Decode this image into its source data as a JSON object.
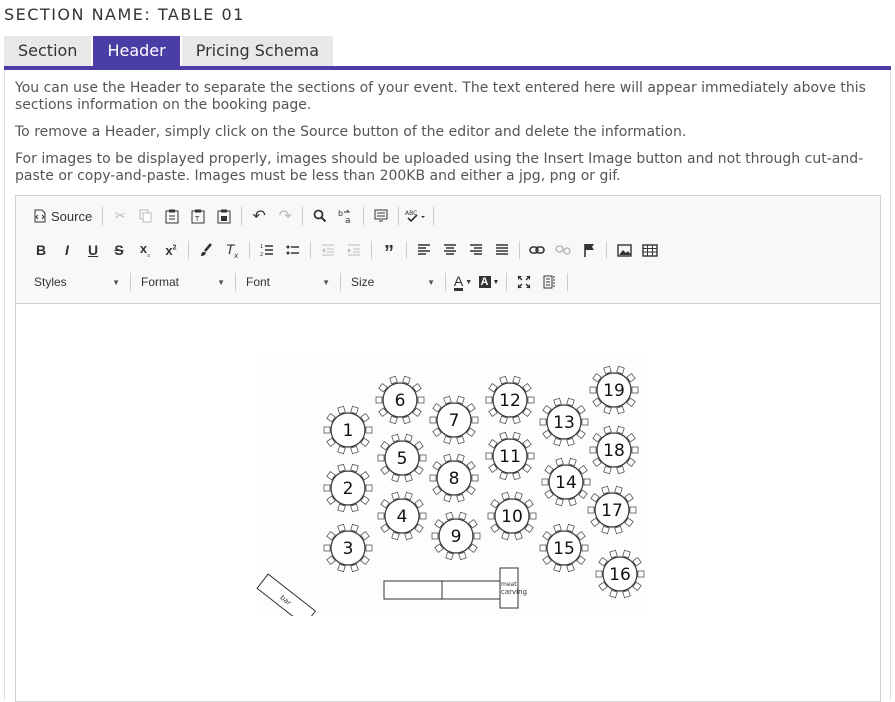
{
  "section_title": "SECTION NAME: TABLE 01",
  "tabs": [
    {
      "label": "Section"
    },
    {
      "label": "Header"
    },
    {
      "label": "Pricing Schema"
    }
  ],
  "paragraphs": [
    "You can use the Header to separate the sections of your event. The text entered here will appear immediately above this sections information on the booking page.",
    "To remove a Header, simply click on the Source button of the editor and delete the information.",
    "For images to be displayed properly, images should be uploaded using the Insert Image button and not through cut-and-paste or copy-and-paste. Images must be less than 200KB and either a jpg, png or gif."
  ],
  "toolbar": {
    "source_label": "Source",
    "combos": {
      "styles": "Styles",
      "format": "Format",
      "font": "Font",
      "size": "Size"
    }
  },
  "floor_plan": {
    "tables": [
      "1",
      "2",
      "3",
      "4",
      "5",
      "6",
      "7",
      "8",
      "9",
      "10",
      "11",
      "12",
      "13",
      "14",
      "15",
      "16",
      "17",
      "18",
      "19"
    ],
    "labels": {
      "bar": "bar",
      "meat_carving_1": "meat",
      "meat_carving_2": "carving"
    }
  },
  "colors": {
    "accent": "#4b3da6",
    "tab_bg": "#e8e8e8",
    "toolbar_bg": "#f8f8f8"
  }
}
